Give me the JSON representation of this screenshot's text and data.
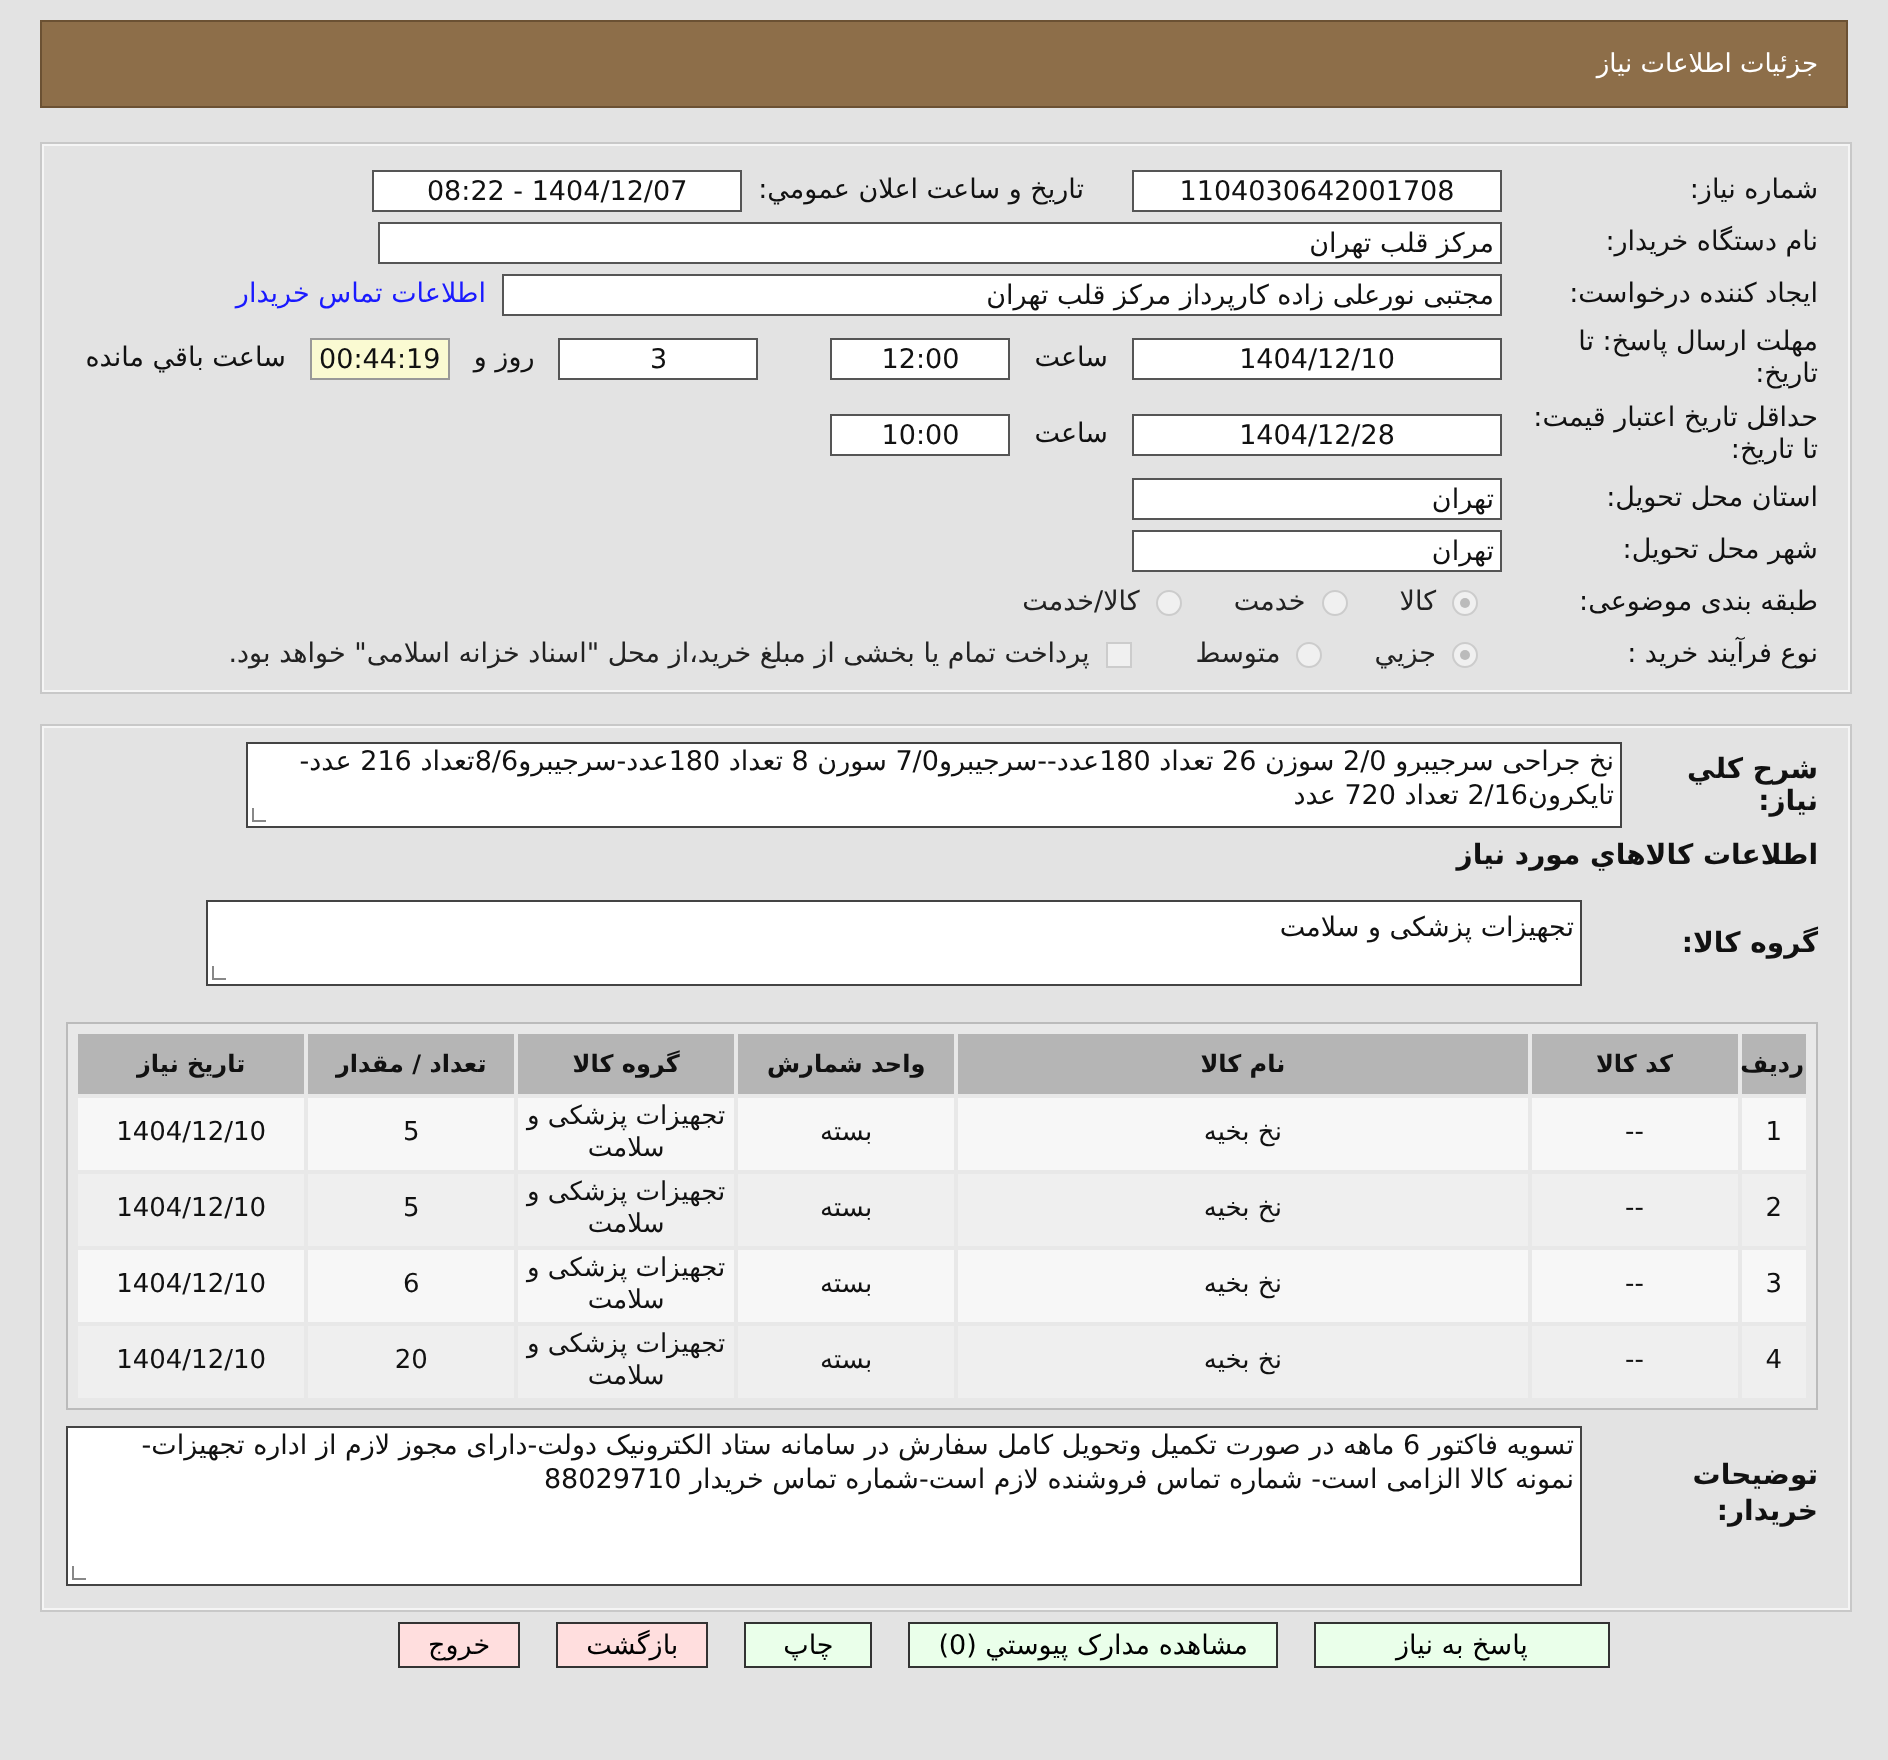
{
  "header": {
    "title": "جزئیات اطلاعات نیاز"
  },
  "need_number": {
    "label": "شماره نیاز:",
    "value": "1104030642001708"
  },
  "announce": {
    "label": "تاریخ و ساعت اعلان عمومي:",
    "value": "1404/12/07 - 08:22"
  },
  "buyer_org": {
    "label": "نام دستگاه خریدار:",
    "value": "مرکز قلب تهران"
  },
  "requester": {
    "label": "ایجاد کننده درخواست:",
    "value": "مجتبی نورعلی زاده کارپرداز مرکز قلب تهران",
    "link": "اطلاعات تماس خریدار"
  },
  "deadline": {
    "label": "مهلت ارسال پاسخ: تا تاریخ:",
    "date": "1404/12/10",
    "time_label": "ساعت",
    "time": "12:00",
    "days": "3",
    "days_label": "روز و",
    "remaining": "00:44:19",
    "remaining_label": "ساعت باقي مانده"
  },
  "validity": {
    "label": "حداقل تاریخ اعتبار قیمت: تا تاریخ:",
    "date": "1404/12/28",
    "time_label": "ساعت",
    "time": "10:00"
  },
  "province": {
    "label": "استان محل تحویل:",
    "value": "تهران"
  },
  "city": {
    "label": "شهر محل تحویل:",
    "value": "تهران"
  },
  "category": {
    "label": "طبقه بندی موضوعی:",
    "options": [
      {
        "label": "کالا",
        "selected": true
      },
      {
        "label": "خدمت",
        "selected": false
      },
      {
        "label": "کالا/خدمت",
        "selected": false
      }
    ]
  },
  "process": {
    "label": "نوع فرآیند خرید :",
    "options": [
      {
        "label": "جزيي",
        "selected": true
      },
      {
        "label": "متوسط",
        "selected": false
      }
    ],
    "payment": {
      "label": "پرداخت تمام یا بخشی از مبلغ خرید،از محل \"اسناد خزانه اسلامی\" خواهد بود.",
      "checked": false
    }
  },
  "description": {
    "label": "شرح کلي نیاز:",
    "value": "نخ جراحی سرجیبرو 2/0 سوزن 26 تعداد 180عدد--سرجیبرو7/0 سورن 8 تعداد 180عدد-سرجیبرو8/6تعداد 216 عدد-تایکرون2/16 تعداد 720 عدد"
  },
  "goods_heading": "اطلاعات کالاهاي مورد نیاز",
  "goods_group": {
    "label": "گروه کالا:",
    "value": "تجهیزات پزشکی و سلامت"
  },
  "table": {
    "columns": [
      "ردیف",
      "کد کالا",
      "نام کالا",
      "واحد شمارش",
      "گروه کالا",
      "تعداد / مقدار",
      "تاریخ نیاز"
    ],
    "rows": [
      [
        "1",
        "--",
        "نخ بخیه",
        "بسته",
        "تجهیزات پزشکی و سلامت",
        "5",
        "1404/12/10"
      ],
      [
        "2",
        "--",
        "نخ بخیه",
        "بسته",
        "تجهیزات پزشکی و سلامت",
        "5",
        "1404/12/10"
      ],
      [
        "3",
        "--",
        "نخ بخیه",
        "بسته",
        "تجهیزات پزشکی و سلامت",
        "6",
        "1404/12/10"
      ],
      [
        "4",
        "--",
        "نخ بخیه",
        "بسته",
        "تجهیزات پزشکی و سلامت",
        "20",
        "1404/12/10"
      ]
    ]
  },
  "notes": {
    "label": "توضیحات خریدار:",
    "value": "تسویه فاکتور 6 ماهه در صورت تکمیل وتحویل کامل سفارش در سامانه  ستاد الکترونیک دولت-دارای مجوز لازم از اداره تجهیزات-نمونه کالا الزامی است- شماره تماس فروشنده لازم است-شماره تماس خریدار 88029710"
  },
  "buttons": [
    {
      "label": "پاسخ به نیاز",
      "kind": "action"
    },
    {
      "label": "مشاهده مدارک پیوستي (0)",
      "kind": "action"
    },
    {
      "label": "چاپ",
      "kind": "action"
    },
    {
      "label": "بازگشت",
      "kind": "exit"
    },
    {
      "label": "خروج",
      "kind": "exit"
    }
  ]
}
